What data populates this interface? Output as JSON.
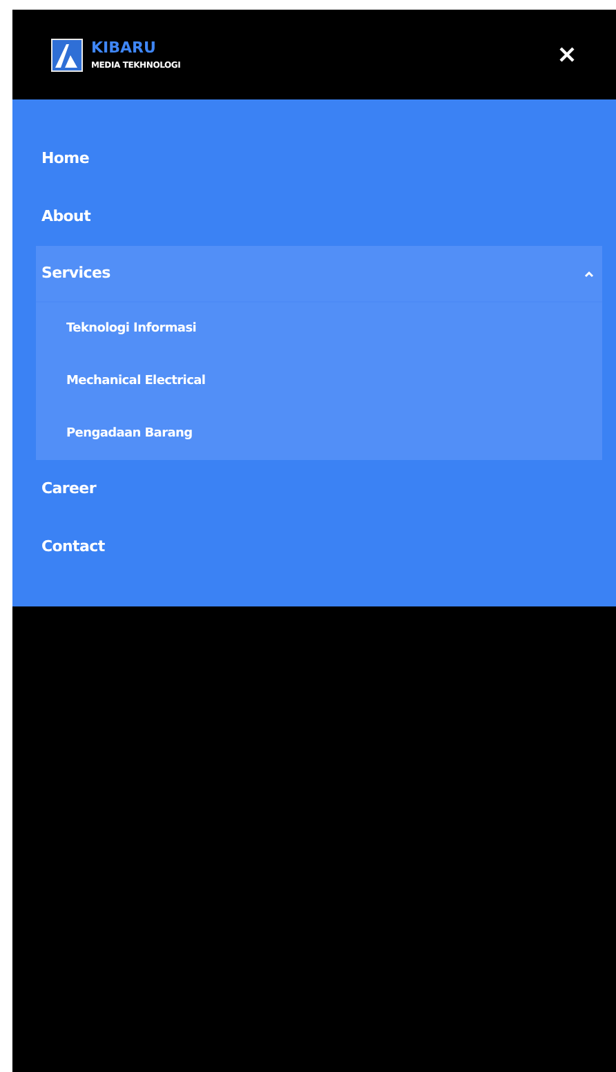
{
  "brand": {
    "name": "KIBARU",
    "tagline": "MEDIA TEKHNOLOGI"
  },
  "menu": [
    {
      "label": "Home"
    },
    {
      "label": "About"
    },
    {
      "label": "Services",
      "expanded": true,
      "children": [
        {
          "label": "Teknologi Informasi"
        },
        {
          "label": "Mechanical Electrical"
        },
        {
          "label": "Pengadaan Barang"
        }
      ]
    },
    {
      "label": "Career"
    },
    {
      "label": "Contact"
    }
  ]
}
